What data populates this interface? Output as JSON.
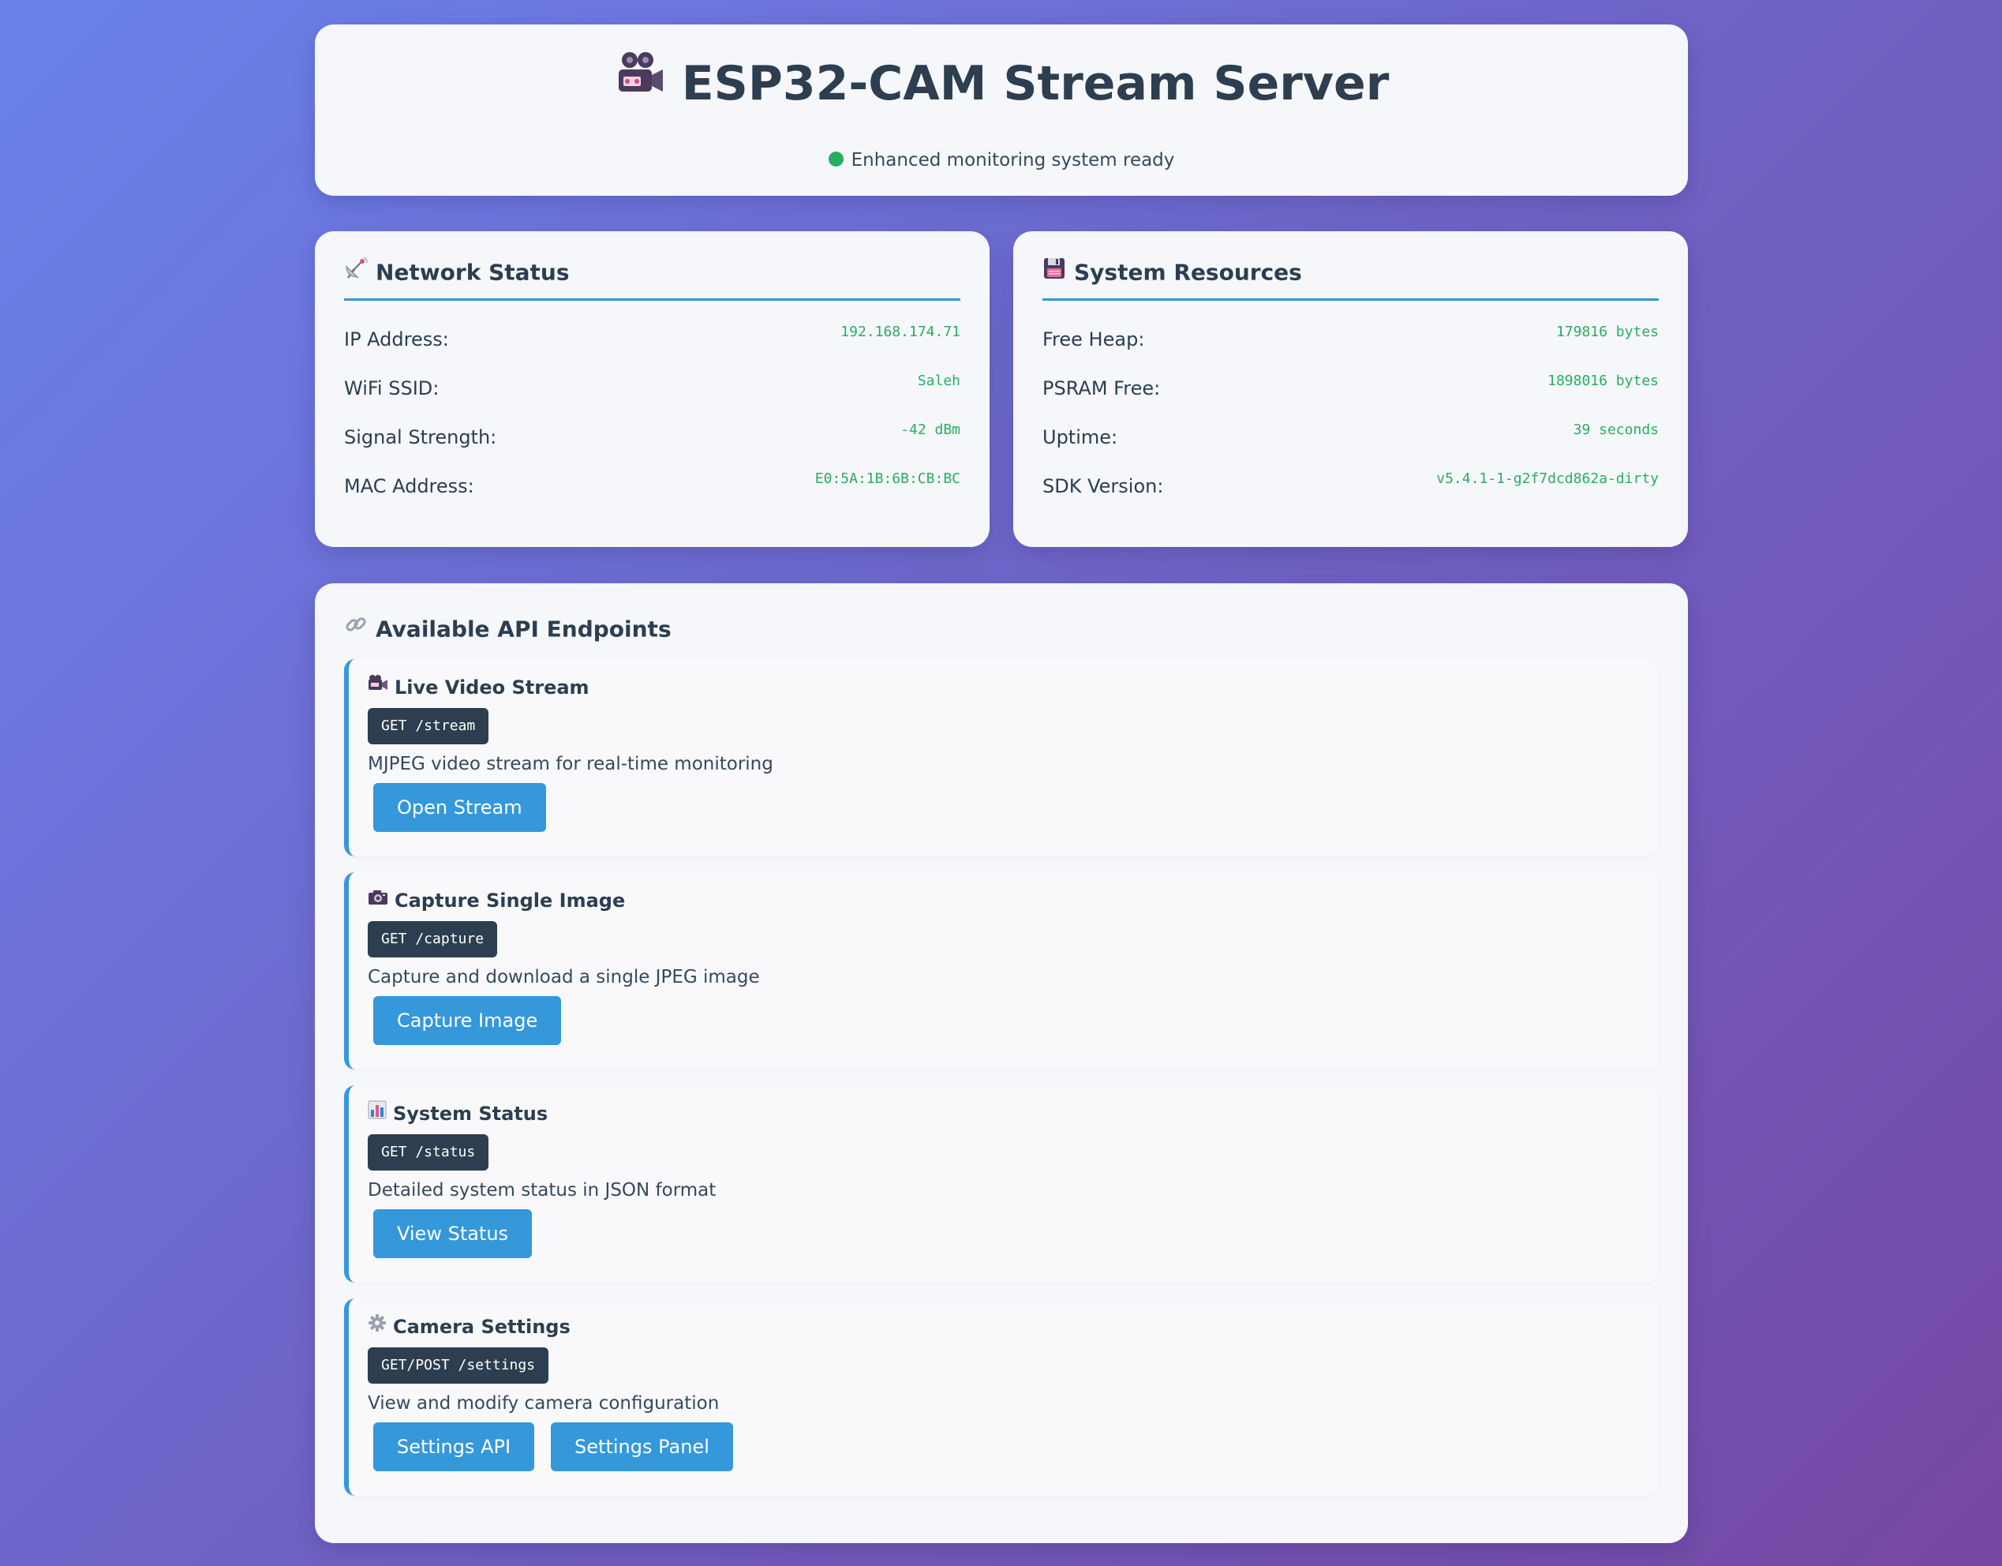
{
  "header": {
    "title": "ESP32-CAM Stream Server",
    "status_text": "Enhanced monitoring system ready",
    "title_icon": "video-camera-icon",
    "status_color": "#27ae60"
  },
  "network": {
    "heading": "Network Status",
    "icon": "satellite-dish-icon",
    "rows": [
      {
        "label": "IP Address:",
        "value": "192.168.174.71"
      },
      {
        "label": "WiFi SSID:",
        "value": "Saleh"
      },
      {
        "label": "Signal Strength:",
        "value": "-42 dBm"
      },
      {
        "label": "MAC Address:",
        "value": "E0:5A:1B:6B:CB:BC"
      }
    ]
  },
  "resources": {
    "heading": "System Resources",
    "icon": "floppy-disk-icon",
    "rows": [
      {
        "label": "Free Heap:",
        "value": "179816 bytes"
      },
      {
        "label": "PSRAM Free:",
        "value": "1898016 bytes"
      },
      {
        "label": "Uptime:",
        "value": "39 seconds"
      },
      {
        "label": "SDK Version:",
        "value": "v5.4.1-1-g2f7dcd862a-dirty"
      }
    ]
  },
  "endpoints": {
    "heading": "Available API Endpoints",
    "icon": "link-icon",
    "items": [
      {
        "title": "Live Video Stream",
        "icon": "video-camera-icon",
        "method": "GET /stream",
        "description": "MJPEG video stream for real-time monitoring",
        "buttons": [
          "Open Stream"
        ]
      },
      {
        "title": "Capture Single Image",
        "icon": "camera-icon",
        "method": "GET /capture",
        "description": "Capture and download a single JPEG image",
        "buttons": [
          "Capture Image"
        ]
      },
      {
        "title": "System Status",
        "icon": "bar-chart-icon",
        "method": "GET /status",
        "description": "Detailed system status in JSON format",
        "buttons": [
          "View Status"
        ]
      },
      {
        "title": "Camera Settings",
        "icon": "gear-icon",
        "method": "GET/POST /settings",
        "description": "View and modify camera configuration",
        "buttons": [
          "Settings API",
          "Settings Panel"
        ]
      }
    ]
  },
  "colors": {
    "accent": "#3498db",
    "value_text": "#27ae60",
    "dark": "#2c3e50"
  }
}
